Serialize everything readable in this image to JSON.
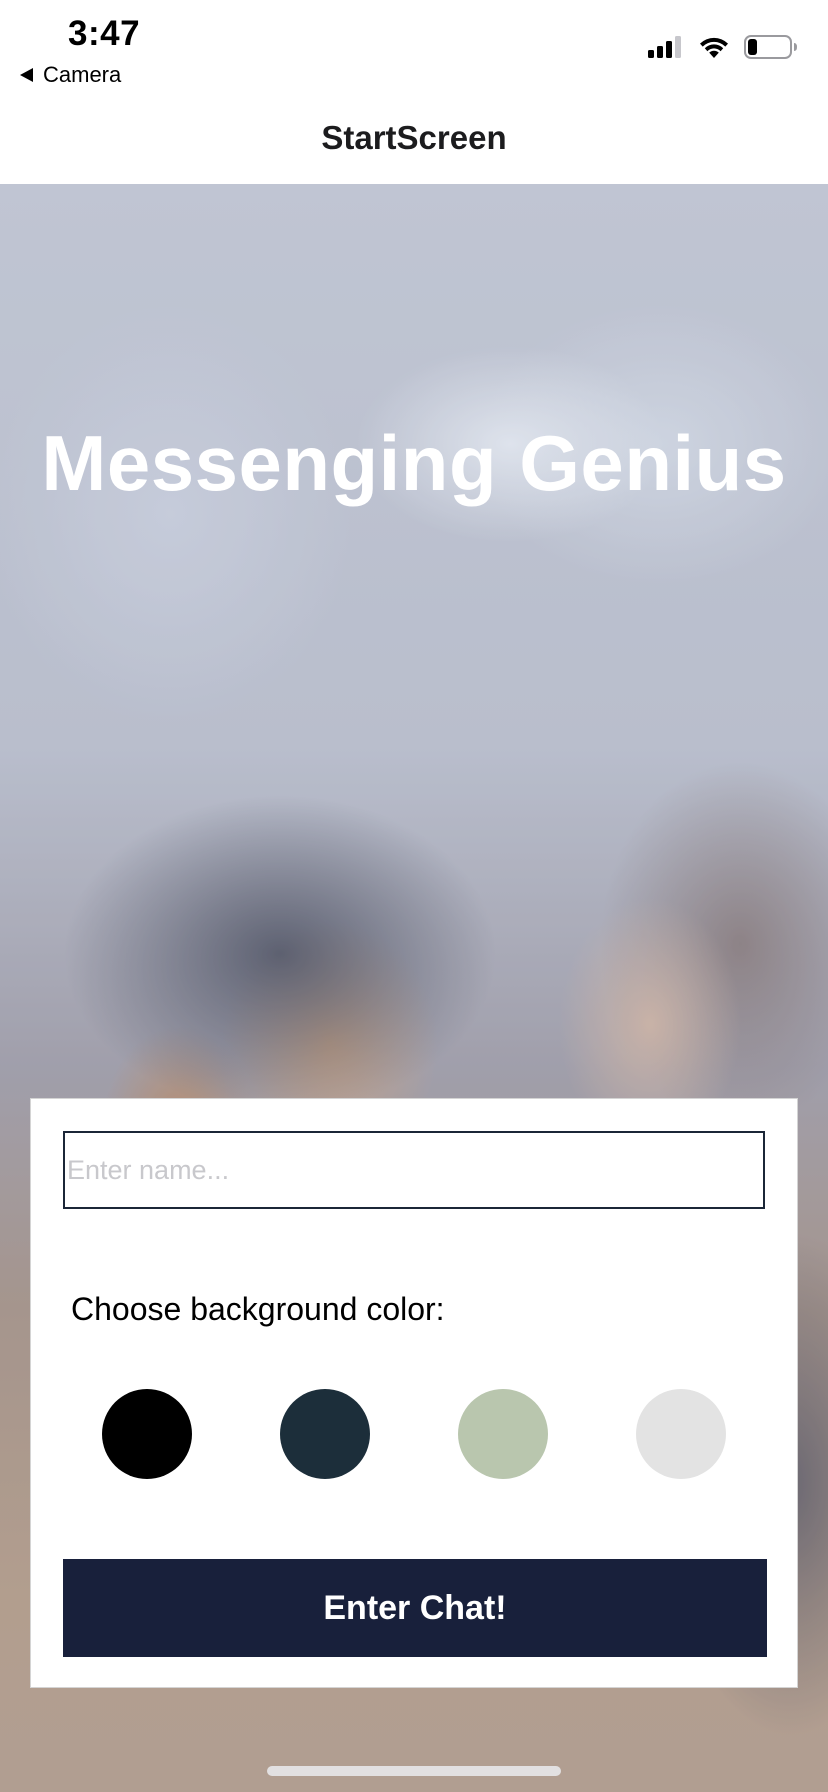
{
  "status_bar": {
    "time": "3:47",
    "back_app_label": "Camera",
    "icons": [
      "cellular-signal-icon",
      "wifi-icon",
      "battery-icon"
    ]
  },
  "nav": {
    "title": "StartScreen"
  },
  "hero": {
    "title": "Messenging Genius"
  },
  "form": {
    "name_value": "",
    "name_placeholder": "Enter name...",
    "choose_label": "Choose background color:",
    "colors": [
      "#000000",
      "#1c2e3a",
      "#b9c6ae",
      "#e3e3e3"
    ],
    "button_label": "Enter Chat!",
    "button_color": "#18203b"
  }
}
